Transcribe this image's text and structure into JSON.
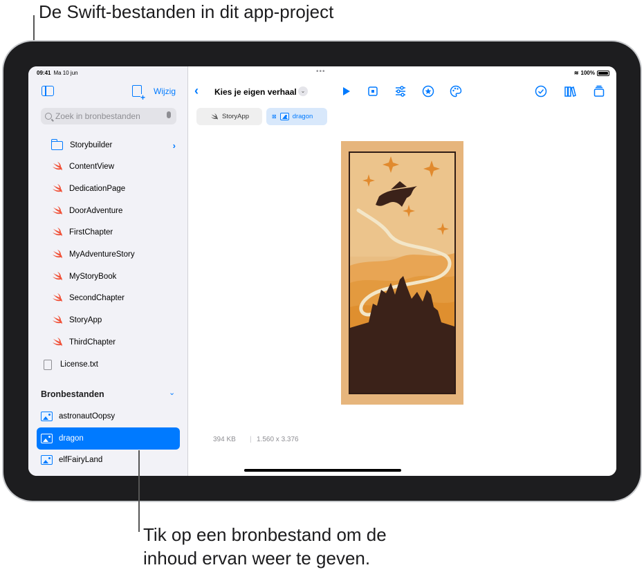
{
  "callouts": {
    "top": "De Swift-bestanden in dit app-project",
    "bottom": "Tik op een bronbestand om de inhoud ervan weer te geven."
  },
  "status_bar": {
    "time": "09:41",
    "date": "Ma 10 jun",
    "battery": "100%"
  },
  "sidebar": {
    "edit_label": "Wijzig",
    "search_placeholder": "Zoek in bronbestanden",
    "folder": {
      "label": "Storybuilder"
    },
    "swift_files": [
      "ContentView",
      "DedicationPage",
      "DoorAdventure",
      "FirstChapter",
      "MyAdventureStory",
      "MyStoryBook",
      "SecondChapter",
      "StoryApp",
      "ThirdChapter"
    ],
    "license_file": "License.txt",
    "resources_header": "Bronbestanden",
    "resources": [
      {
        "label": "astronautOopsy",
        "selected": false
      },
      {
        "label": "dragon",
        "selected": true
      },
      {
        "label": "elfFairyLand",
        "selected": false
      }
    ]
  },
  "main": {
    "nav_title": "Kies je eigen verhaal",
    "toolbar_icons": [
      "play-icon",
      "stop-icon",
      "settings-sliders-icon",
      "star-icon",
      "palette-icon",
      "checkmark-icon",
      "library-icon",
      "tabs-icon",
      "more-icon"
    ],
    "tabs": [
      {
        "label": "StoryApp",
        "active": false
      },
      {
        "label": "dragon",
        "active": true
      }
    ],
    "file_size": "394 KB",
    "file_dimensions": "1.560 x 3.376"
  },
  "colors": {
    "accent": "#007aff",
    "swift_orange": "#f05138",
    "poster_frame": "#e6b57c",
    "poster_dark": "#3b2219"
  }
}
